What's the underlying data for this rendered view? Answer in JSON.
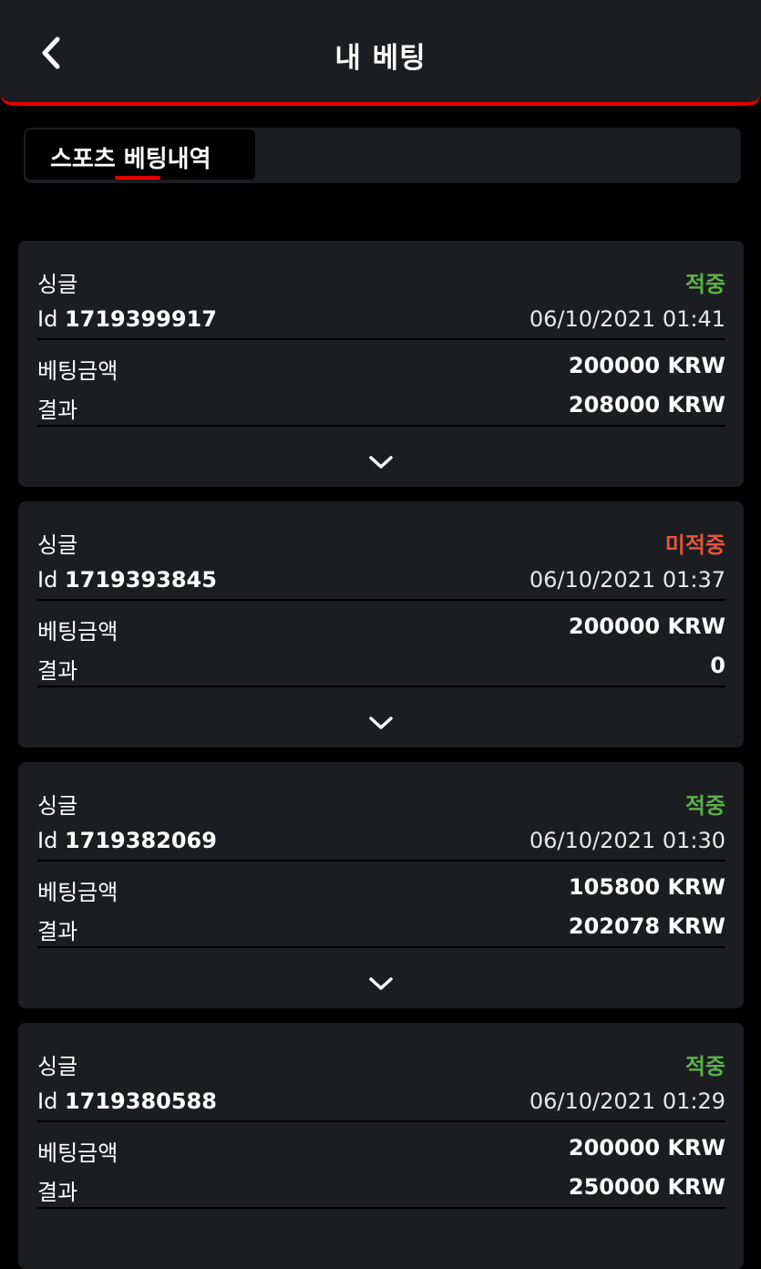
{
  "header": {
    "title": "내 베팅",
    "back_icon": "chevron-left-icon"
  },
  "tabs": [
    {
      "label": "스포츠 베팅내역",
      "active": true
    }
  ],
  "colors": {
    "accent": "#e60000",
    "win": "#5bb04a",
    "lose": "#e8553a",
    "card_bg": "#1c1d21",
    "page_bg": "#000000"
  },
  "labels": {
    "id_prefix": "Id",
    "stake_label": "베팅금액",
    "result_label": "결과",
    "expand_icon": "chevron-down-icon"
  },
  "bets": [
    {
      "type": "싱글",
      "status": "적중",
      "status_kind": "win",
      "id": "1719399917",
      "datetime": "06/10/2021 01:41",
      "stake": "200000 KRW",
      "result": "208000 KRW"
    },
    {
      "type": "싱글",
      "status": "미적중",
      "status_kind": "lose",
      "id": "1719393845",
      "datetime": "06/10/2021 01:37",
      "stake": "200000 KRW",
      "result": "0"
    },
    {
      "type": "싱글",
      "status": "적중",
      "status_kind": "win",
      "id": "1719382069",
      "datetime": "06/10/2021 01:30",
      "stake": "105800 KRW",
      "result": "202078 KRW"
    },
    {
      "type": "싱글",
      "status": "적중",
      "status_kind": "win",
      "id": "1719380588",
      "datetime": "06/10/2021 01:29",
      "stake": "200000 KRW",
      "result": "250000 KRW"
    }
  ]
}
